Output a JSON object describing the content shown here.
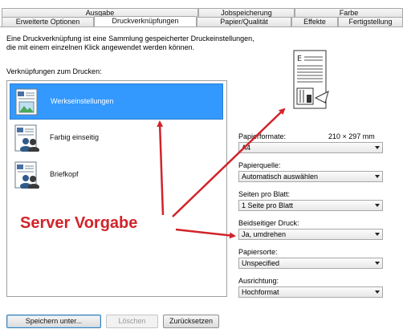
{
  "tabs_top": [
    "Ausgabe",
    "Jobspeicherung",
    "Farbe"
  ],
  "tabs_bottom": [
    "Erweiterte Optionen",
    "Druckverknüpfungen",
    "Papier/Qualität",
    "Effekte",
    "Fertigstellung"
  ],
  "description_line1": "Eine Druckverknüpfung ist eine Sammlung gespeicherter Druckeinstellungen,",
  "description_line2": "die mit einem einzelnen Klick angewendet werden können.",
  "list_label": "Verknüpfungen zum Drucken:",
  "shortcuts": [
    {
      "label": "Werkseinstellungen",
      "selected": true
    },
    {
      "label": "Farbig einseitig",
      "selected": false
    },
    {
      "label": "Briefkopf",
      "selected": false
    }
  ],
  "paper_size_label": "Papierformate:",
  "paper_size_dims": "210 × 297 mm",
  "settings": [
    {
      "label": "Papierformate:",
      "value": "A4"
    },
    {
      "label": "Papierquelle:",
      "value": "Automatisch auswählen"
    },
    {
      "label": "Seiten pro Blatt:",
      "value": "1 Seite pro Blatt"
    },
    {
      "label": "Beidseitiger Druck:",
      "value": "Ja, umdrehen"
    },
    {
      "label": "Papiersorte:",
      "value": "Unspecified"
    },
    {
      "label": "Ausrichtung:",
      "value": "Hochformat"
    }
  ],
  "buttons": {
    "save_as": "Speichern unter...",
    "delete": "Löschen",
    "reset": "Zurücksetzen"
  },
  "annotation_text": "Server Vorgabe",
  "colors": {
    "selection": "#3399ff",
    "annotation": "#d2232a"
  }
}
